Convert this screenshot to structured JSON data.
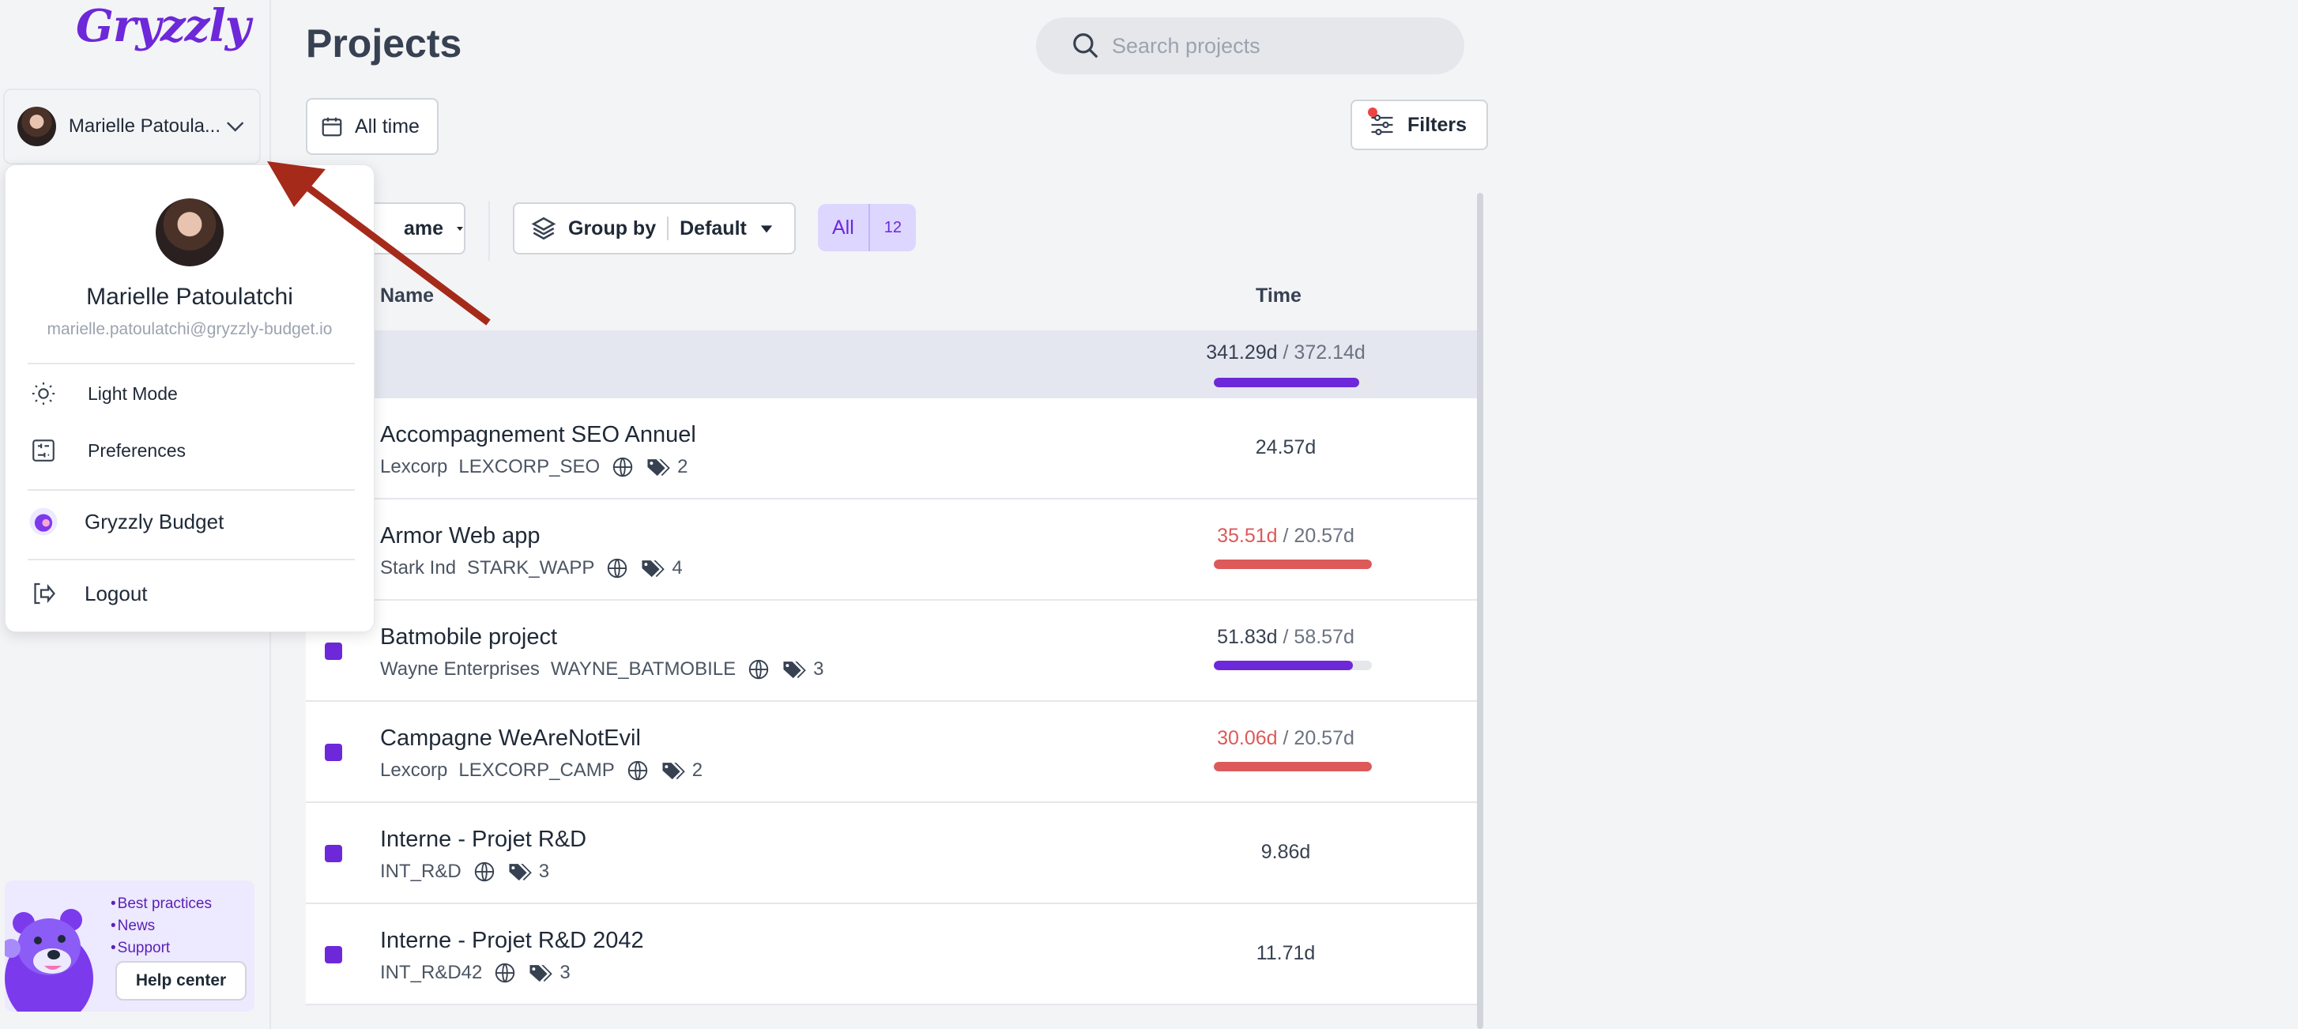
{
  "brand": {
    "logo_text": "Gryzzly"
  },
  "user": {
    "selector_name": "Marielle Patoula...",
    "full_name": "Marielle Patoulatchi",
    "email": "marielle.patoulatchi@gryzzly-budget.io"
  },
  "user_menu": {
    "items": [
      {
        "label": "Light Mode",
        "icon": "sun-icon"
      },
      {
        "label": "Preferences",
        "icon": "sliders-icon"
      },
      {
        "label": "Gryzzly Budget",
        "icon": "workspace-logo-icon"
      },
      {
        "label": "Logout",
        "icon": "logout-icon"
      }
    ]
  },
  "help": {
    "links": [
      "Best practices",
      "News",
      "Support"
    ],
    "button_label": "Help center"
  },
  "header": {
    "title": "Projects",
    "search_placeholder": "Search projects",
    "period_label": "All time",
    "filters_label": "Filters"
  },
  "toolbar": {
    "sort_label": "ame",
    "group_by_label": "Group by",
    "group_by_value": "Default",
    "all_label": "All",
    "all_count": "12"
  },
  "columns": {
    "name": "Name",
    "time": "Time"
  },
  "total": {
    "spent": "341.29d",
    "separator": " / ",
    "budget": "372.14d",
    "progress": 0.92
  },
  "projects": [
    {
      "name": "Accompagnement SEO Annuel",
      "client": "Lexcorp",
      "code": "LEXCORP_SEO",
      "tags": "2",
      "spent": "24.57d",
      "budget": "",
      "over": false,
      "progress": null
    },
    {
      "name": "Armor Web app",
      "client": "Stark Ind",
      "code": "STARK_WAPP",
      "tags": "4",
      "spent": "35.51d",
      "budget": "20.57d",
      "over": true,
      "progress": 1.0
    },
    {
      "name": "Batmobile project",
      "client": "Wayne Enterprises",
      "code": "WAYNE_BATMOBILE",
      "tags": "3",
      "spent": "51.83d",
      "budget": "58.57d",
      "over": false,
      "progress": 0.88
    },
    {
      "name": "Campagne WeAreNotEvil",
      "client": "Lexcorp",
      "code": "LEXCORP_CAMP",
      "tags": "2",
      "spent": "30.06d",
      "budget": "20.57d",
      "over": true,
      "progress": 1.0
    },
    {
      "name": "Interne - Projet R&D",
      "client": "",
      "code": "INT_R&D",
      "tags": "3",
      "spent": "9.86d",
      "budget": "",
      "over": false,
      "progress": null
    },
    {
      "name": "Interne - Projet R&D 2042",
      "client": "",
      "code": "INT_R&D42",
      "tags": "3",
      "spent": "11.71d",
      "budget": "",
      "over": false,
      "progress": null
    }
  ],
  "colors": {
    "accent": "#6d28d9",
    "over_budget": "#dc5a5a",
    "arrow": "#a52a1a"
  }
}
